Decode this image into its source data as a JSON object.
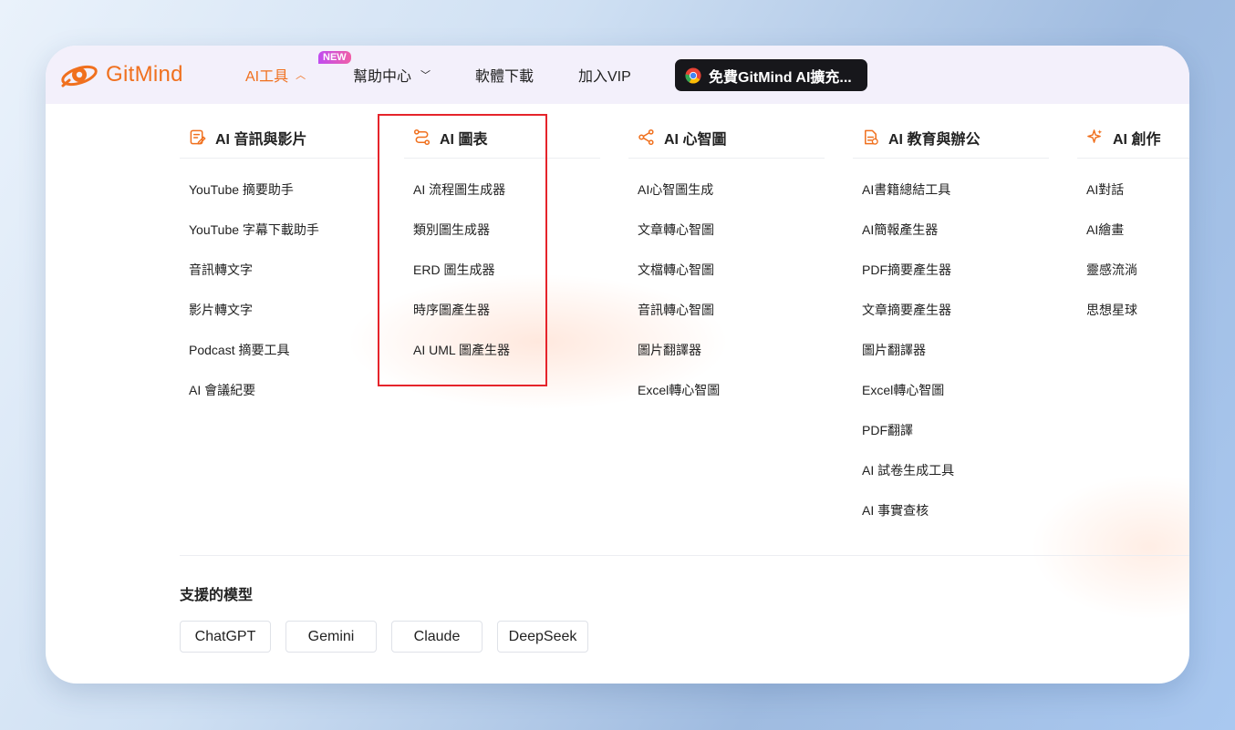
{
  "brand": {
    "name": "GitMind",
    "color": "#f0701e"
  },
  "nav": {
    "ai_tools": "AI工具",
    "new_badge": "NEW",
    "help_center": "幫助中心",
    "download": "軟體下載",
    "vip": "加入VIP",
    "extension_button": "免費GitMind AI擴充..."
  },
  "menu": {
    "columns": [
      {
        "icon": "edit-note-icon",
        "title": "AI 音訊與影片",
        "items": [
          "YouTube 摘要助手",
          "YouTube 字幕下載助手",
          "音訊轉文字",
          "影片轉文字",
          "Podcast 摘要工具",
          "AI 會議紀要"
        ]
      },
      {
        "icon": "flowchart-icon",
        "title": "AI 圖表",
        "items": [
          "AI 流程圖生成器",
          "類別圖生成器",
          "ERD 圖生成器",
          "時序圖產生器",
          "AI UML 圖產生器"
        ]
      },
      {
        "icon": "mindmap-icon",
        "title": "AI 心智圖",
        "items": [
          "AI心智圖生成",
          "文章轉心智圖",
          "文檔轉心智圖",
          "音訊轉心智圖",
          "圖片翻譯器",
          "Excel轉心智圖"
        ]
      },
      {
        "icon": "document-icon",
        "title": "AI 教育與辦公",
        "items": [
          "AI書籍總結工具",
          "AI簡報產生器",
          "PDF摘要產生器",
          "文章摘要產生器",
          "圖片翻譯器",
          "Excel轉心智圖",
          "PDF翻譯",
          "AI 試卷生成工具",
          "AI 事實查核"
        ]
      },
      {
        "icon": "sparkle-icon",
        "title": "AI 創作",
        "items": [
          "AI對話",
          "AI繪畫",
          "靈感流淌",
          "思想星球"
        ]
      }
    ]
  },
  "models": {
    "title": "支援的模型",
    "items": [
      "ChatGPT",
      "Gemini",
      "Claude",
      "DeepSeek"
    ]
  },
  "colors": {
    "accent": "#f0701e",
    "highlight_box": "#e5242b"
  }
}
